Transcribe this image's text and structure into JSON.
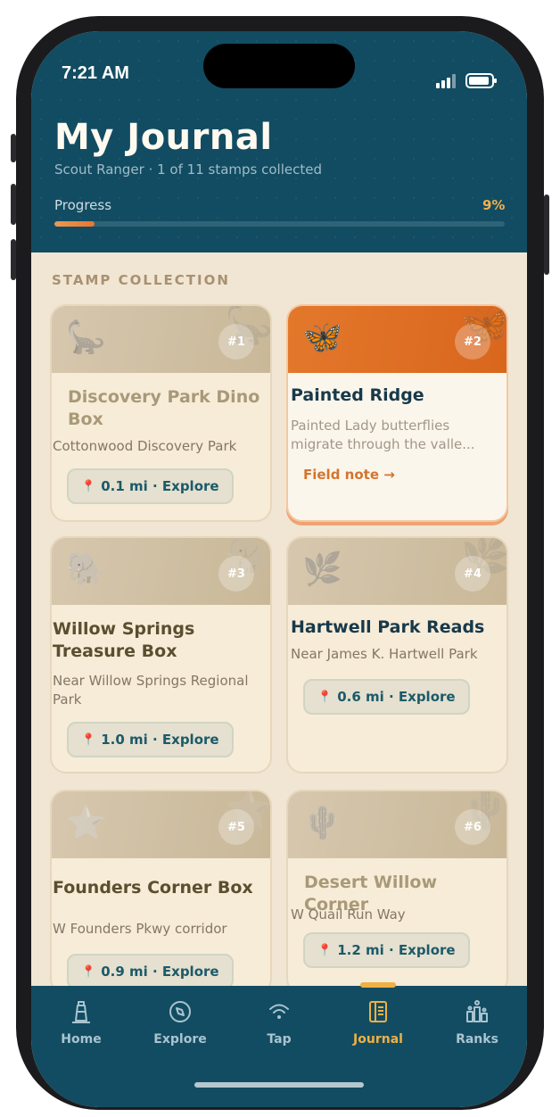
{
  "status_bar": {
    "time": "7:21 AM"
  },
  "header": {
    "title": "My Journal",
    "subtitle": "Scout Ranger · 1 of 11 stamps collected",
    "progress_label": "Progress",
    "progress_percent_text": "9%",
    "progress_fraction": 0.09
  },
  "section_label": "STAMP COLLECTION",
  "cards": [
    {
      "number": "#1",
      "icon": "dinosaur-icon",
      "glyph": "🦕",
      "title": "Discovery Park Dino Box",
      "location": "Cottonwood Discovery Park",
      "action": "0.1 mi · Explore",
      "unlocked": false
    },
    {
      "number": "#2",
      "icon": "butterfly-icon",
      "glyph": "🦋",
      "title": "Painted Ridge",
      "description": "Painted Lady butterflies migrate through the valle...",
      "action": "Field note →",
      "unlocked": true
    },
    {
      "number": "#3",
      "icon": "elephant-icon",
      "glyph": "🐘",
      "title": "Willow Springs Treasure Box",
      "location": "Near Willow Springs Regional Park",
      "action": "1.0 mi · Explore",
      "unlocked": false
    },
    {
      "number": "#4",
      "icon": "herb-icon",
      "glyph": "🌿",
      "title": "Hartwell Park Reads",
      "location": "Near James K. Hartwell Park",
      "action": "0.6 mi · Explore",
      "unlocked": false
    },
    {
      "number": "#5",
      "icon": "star-icon",
      "glyph": "⭐",
      "title": "Founders Corner Box",
      "location": "W Founders Pkwy corridor",
      "action": "0.9 mi · Explore",
      "unlocked": false
    },
    {
      "number": "#6",
      "icon": "cactus-icon",
      "glyph": "🌵",
      "title": "Desert Willow Corner",
      "location": "W Quail Run Way",
      "action": "1.2 mi · Explore",
      "unlocked": false
    }
  ],
  "tabs": [
    {
      "label": "Home",
      "icon": "lighthouse-icon"
    },
    {
      "label": "Explore",
      "icon": "compass-icon"
    },
    {
      "label": "Tap",
      "icon": "wireless-icon"
    },
    {
      "label": "Journal",
      "icon": "journal-icon",
      "active": true
    },
    {
      "label": "Ranks",
      "icon": "podium-icon"
    }
  ],
  "colors": {
    "header": "#124c62",
    "accent": "#efb143",
    "unlocked": "#e3782b",
    "background": "#f1e6d3"
  }
}
